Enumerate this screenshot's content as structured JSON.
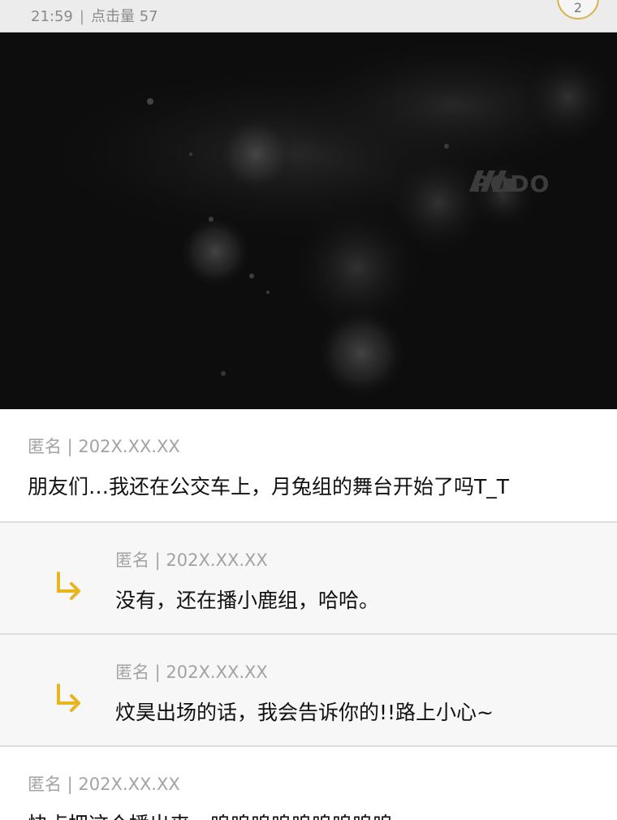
{
  "header": {
    "time": "21:59",
    "separator": "|",
    "views_label": "点击量",
    "views_count": "57",
    "badge_value": "2",
    "badge_color": "#d6b44c"
  },
  "media": {
    "watermark": "PODO",
    "watermark_icon": "podo-logo-icon"
  },
  "comments": [
    {
      "author": "匿名 | 202X.XX.XX",
      "text": "朋友们…我还在公交车上，月兔组的舞台开始了吗T_T",
      "is_reply": false
    },
    {
      "author": "匿名 | 202X.XX.XX",
      "text": "没有，还在播小鹿组，哈哈。",
      "is_reply": true,
      "icon": "reply-arrow-icon"
    },
    {
      "author": "匿名 | 202X.XX.XX",
      "text": "炆昊出场的话，我会告诉你的!!路上小心~",
      "is_reply": true,
      "icon": "reply-arrow-icon"
    },
    {
      "author": "匿名 | 202X.XX.XX",
      "text": "快点把这个播出来，呜呜呜呜呜呜呜呜呜",
      "is_reply": false
    }
  ],
  "colors": {
    "accent": "#e8b51f",
    "reply_bg": "#f7f7f7",
    "muted_text": "#a3a3a3"
  }
}
